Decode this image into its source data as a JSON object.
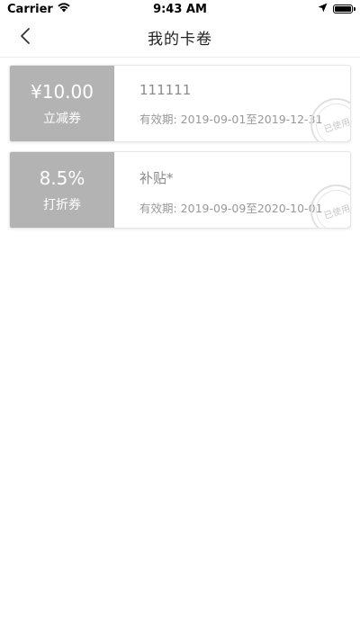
{
  "status_bar": {
    "carrier": "Carrier",
    "time": "9:43 AM",
    "icons": [
      "wifi-icon",
      "location-icon",
      "battery-icon"
    ]
  },
  "nav": {
    "title": "我的卡卷",
    "back_icon": "chevron-left-icon"
  },
  "coupons": [
    {
      "value": "¥10.00",
      "type": "立减券",
      "name": "111111",
      "validity": "有效期: 2019-09-01至2019-12-31",
      "status": "已使用"
    },
    {
      "value": "8.5%",
      "type": "打折券",
      "name": "补贴*",
      "validity": "有效期: 2019-09-09至2020-10-01",
      "status": "已使用"
    }
  ],
  "colors": {
    "coupon_left_bg": "#b3b3b3",
    "stamp": "#c8c8c8"
  }
}
